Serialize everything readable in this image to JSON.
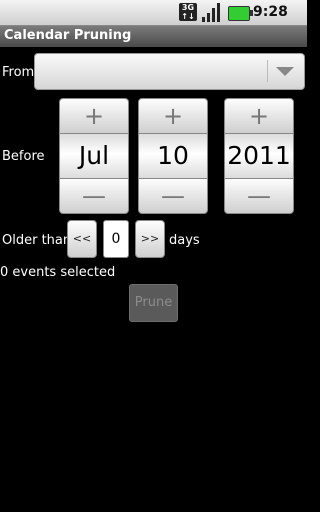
{
  "status_bar": {
    "network_label": "3G",
    "time": "9:28",
    "icons": [
      "3g-icon",
      "signal-icon",
      "battery-icon"
    ]
  },
  "app": {
    "title": "Calendar Pruning"
  },
  "from": {
    "label": "From",
    "selected": ""
  },
  "before": {
    "label": "Before",
    "month": "Jul",
    "day": "10",
    "year": "2011",
    "plus_symbol": "+",
    "minus_symbol": "—"
  },
  "older_than": {
    "label": "Older than",
    "decrement_label": "<<",
    "value": "0",
    "increment_label": ">>",
    "unit": "days"
  },
  "events_selected": "0 events selected",
  "prune_button": {
    "label": "Prune",
    "enabled": false
  }
}
